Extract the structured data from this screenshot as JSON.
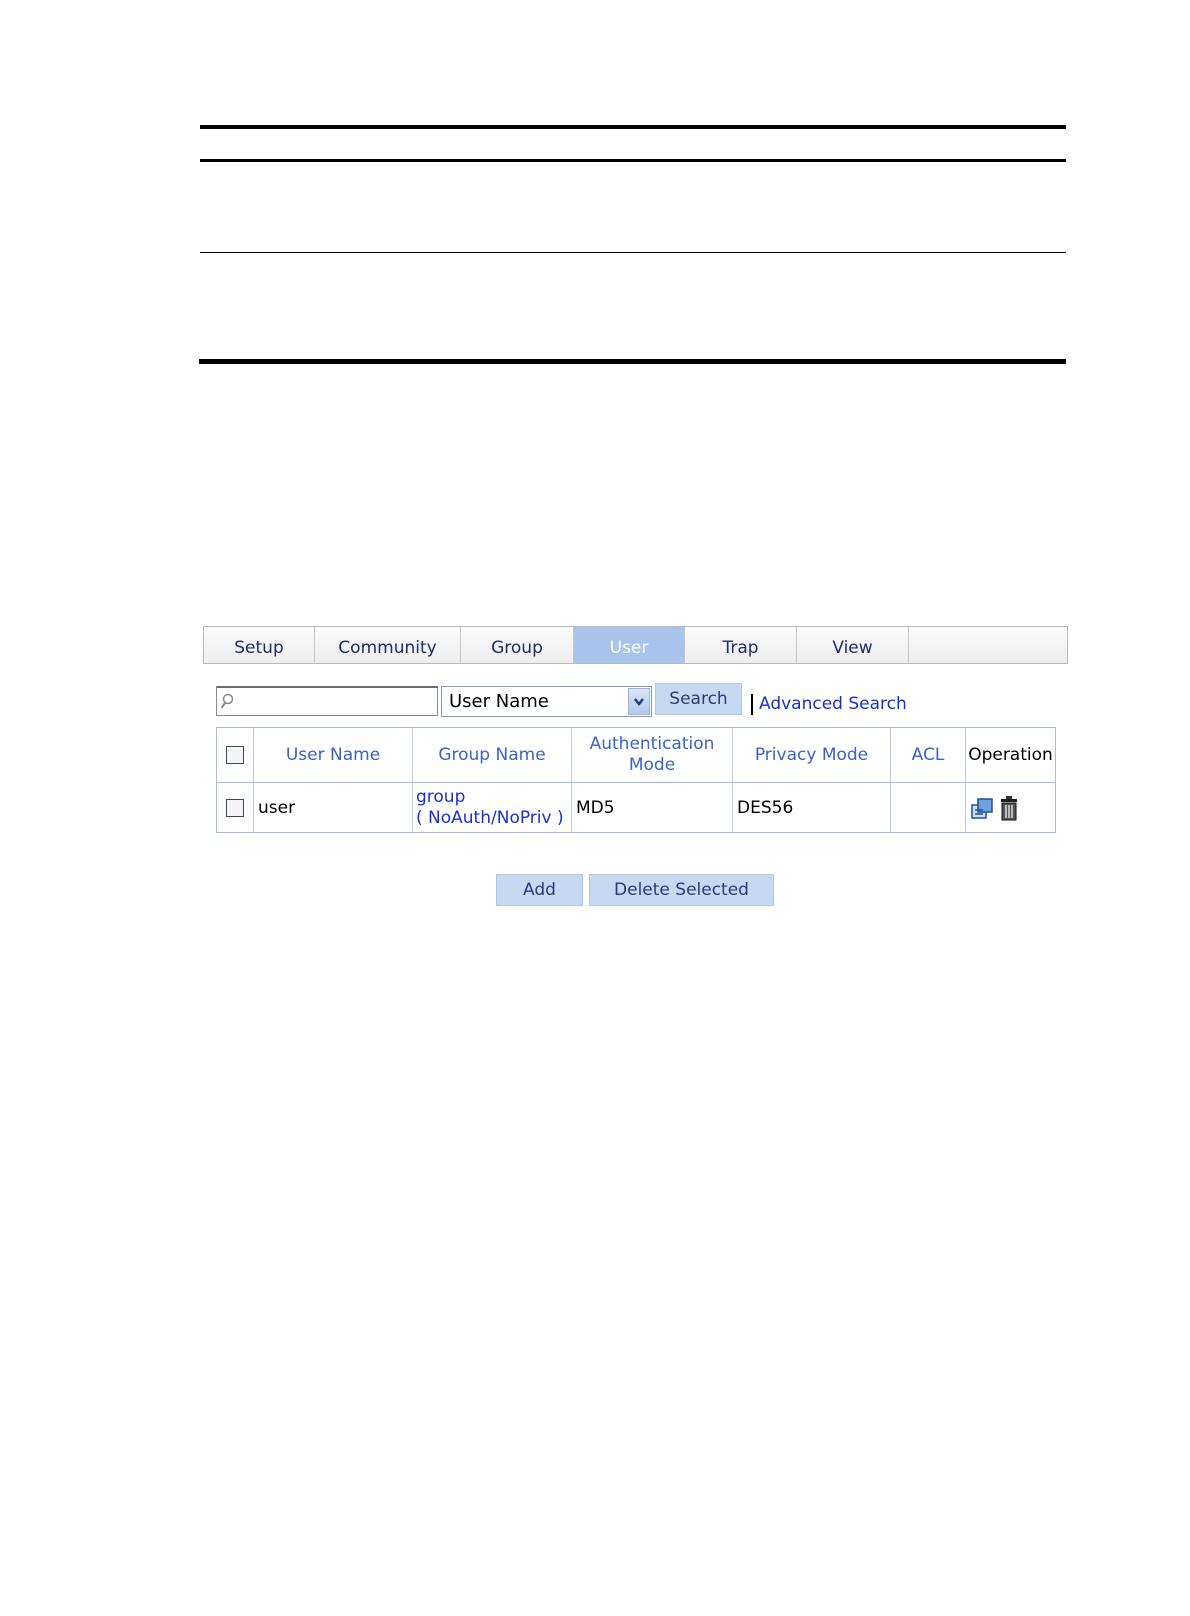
{
  "tabs": [
    {
      "label": "Setup"
    },
    {
      "label": "Community"
    },
    {
      "label": "Group"
    },
    {
      "label": "User",
      "active": true
    },
    {
      "label": "Trap"
    },
    {
      "label": "View"
    }
  ],
  "search": {
    "input_value": "",
    "field_select": "User Name",
    "search_label": "Search",
    "advanced_label": "Advanced Search"
  },
  "table": {
    "columns": [
      "User Name",
      "Group Name",
      "Authentication Mode",
      "Privacy Mode",
      "ACL",
      "Operation"
    ],
    "rows": [
      {
        "user_name": "user",
        "group_name": "group",
        "group_mode": "( NoAuth/NoPriv )",
        "auth_mode": "MD5",
        "privacy_mode": "DES56",
        "acl": ""
      }
    ]
  },
  "buttons": {
    "add_label": "Add",
    "delete_label": "Delete Selected"
  },
  "icons": {
    "edit": "edit-icon",
    "delete": "trash-icon"
  },
  "colors": {
    "tab_active": "#a9c4eb",
    "header_text": "#3a63c9",
    "link": "#1a2fd0",
    "button": "#c6d8f2"
  }
}
